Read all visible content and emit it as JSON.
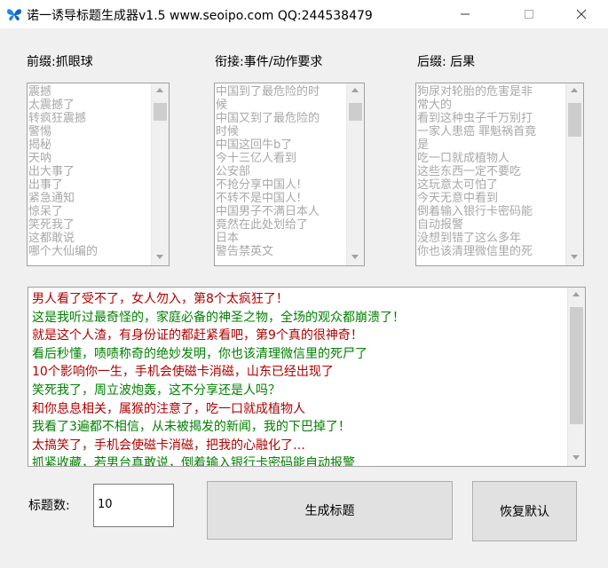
{
  "window": {
    "title": "诺一诱导标题生成器v1.5  www.seoipo.com  QQ:244538479"
  },
  "labels": {
    "prefix": "前缀:抓眼球",
    "connector": "衔接:事件/动作要求",
    "suffix": "后缀: 后果",
    "count": "标题数:"
  },
  "prefix_list": [
    "震撼",
    "太震撼了",
    "转疯狂震撼",
    "警惕",
    "揭秘",
    "天呐",
    "出大事了",
    "出事了",
    "紧急通知",
    "惊呆了",
    "笑死我了",
    "这都敢说",
    "哪个大仙编的"
  ],
  "connector_list": [
    "中国到了最危险的时",
    "候",
    "中国又到了最危险的",
    "时候",
    "中国这回牛b了",
    "今十三亿人看到",
    "公安部",
    "不抢分享中国人!",
    "不转不是中国人!",
    "中国男子不满日本人",
    "竟然在此处划给了",
    "日本",
    "警告禁英文"
  ],
  "suffix_list": [
    "狗尿对轮胎的危害是非",
    "常大的",
    "看到这种虫子千万别打",
    "一家人患癌 罪魁祸首竟",
    "是",
    "吃一口就成植物人",
    "这些东西一定不要吃",
    "这玩意太可怕了",
    "今天无意中看到",
    "倒着输入银行卡密码能",
    "自动报警",
    "没想到错了这么多年",
    "你也该清理微信里的死"
  ],
  "output_lines": [
    {
      "text": "男人看了受不了，女人勿入，第8个太疯狂了！",
      "color": "#b00000"
    },
    {
      "text": "这是我听过最奇怪的，家庭必备的神圣之物，全场的观众都崩溃了！",
      "color": "#008000"
    },
    {
      "text": "就是这个人渣，有身份证的都赶紧看吧，第9个真的很神奇！",
      "color": "#b00000"
    },
    {
      "text": "看后秒懂，啧啧称奇的绝妙发明，你也该清理微信里的死尸了",
      "color": "#008000"
    },
    {
      "text": "10个影响你一生，手机会使磁卡消磁，山东已经出现了",
      "color": "#b00000"
    },
    {
      "text": "笑死我了，周立波炮轰，这不分享还是人吗？",
      "color": "#008000"
    },
    {
      "text": "和你息息相关，属猴的注意了，吃一口就成植物人",
      "color": "#b00000"
    },
    {
      "text": "我看了3遍都不相信，从未被揭发的新闻，我的下巴掉了！",
      "color": "#008000"
    },
    {
      "text": "太搞笑了，手机会使磁卡消磁，把我的心融化了…",
      "color": "#b00000"
    },
    {
      "text": "抓紧收藏，若男台真敢说，倒着输入银行卡密码能自动报警",
      "color": "#008000"
    }
  ],
  "count_input": {
    "value": "10"
  },
  "buttons": {
    "generate": "生成标题",
    "reset": "恢复默认"
  },
  "colors": {
    "red_line": "#b00000",
    "green_line": "#008000",
    "list_text": "#a8a8a8"
  },
  "icons": {
    "app": "butterfly-icon",
    "minimize": "minimize-icon",
    "maximize": "maximize-icon",
    "close": "close-icon"
  }
}
